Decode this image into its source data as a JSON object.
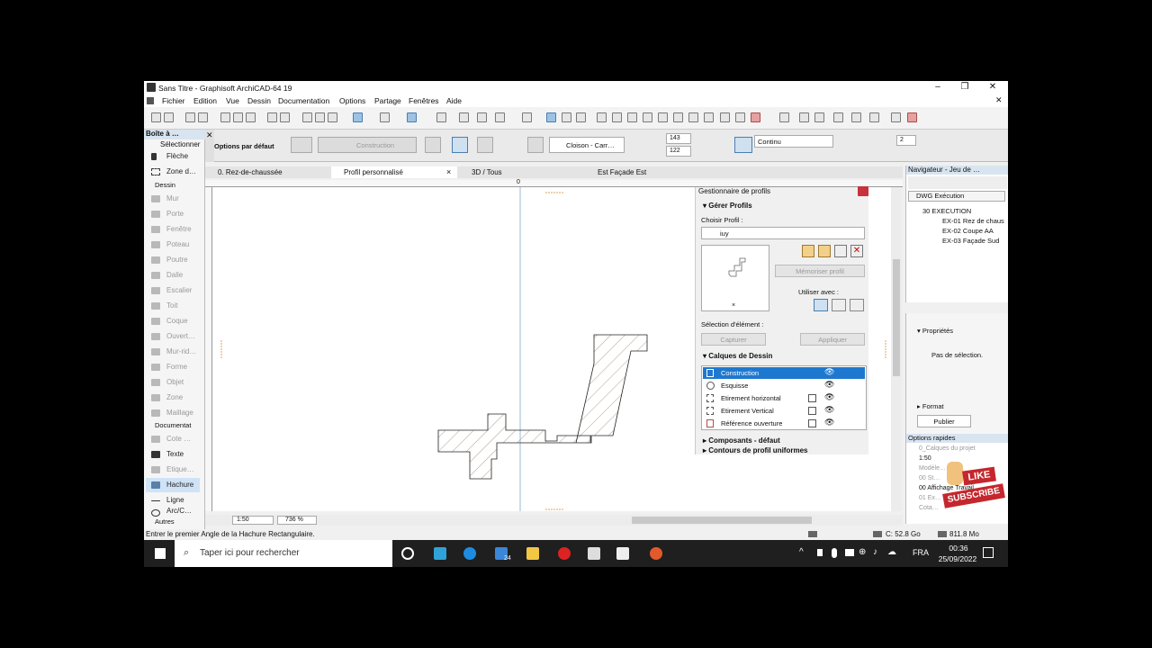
{
  "window": {
    "title": "Sans Titre - Graphisoft ArchiCAD-64 19",
    "min": "–",
    "max": "❐",
    "close": "✕"
  },
  "menus": [
    "Fichier",
    "Edition",
    "Vue",
    "Dessin",
    "Documentation",
    "Options",
    "Partage",
    "Fenêtres",
    "Aide"
  ],
  "infobox": {
    "options": "Options par défaut",
    "layer": "Construction",
    "fill": "Cloison - Carr…",
    "pen1": "143",
    "pen2": "122",
    "line": "Continu",
    "scale_val": "2"
  },
  "toolbox": {
    "header": "Boîte à …",
    "select_label": "Sélectionner",
    "tools": [
      {
        "label": "Flèche"
      },
      {
        "label": "Zone d…"
      }
    ],
    "dessin_header": "Dessin",
    "dessin_tools": [
      "Mur",
      "Porte",
      "Fenêtre",
      "Poteau",
      "Poutre",
      "Dalle",
      "Escalier",
      "Toit",
      "Coque",
      "Ouvert…",
      "Mur-rid…",
      "Forme",
      "Objet",
      "Zone",
      "Maillage"
    ],
    "doc_header": "Documentat",
    "doc_tools": [
      "Cote …",
      "Texte",
      "Etique…",
      "Hachure",
      "Ligne",
      "Arc/C…"
    ],
    "autres": "Autres"
  },
  "tabs": [
    "0. Rez-de-chaussée",
    "Profil personnalisé",
    "3D / Tous",
    "Est Façade Est"
  ],
  "tab_close": "×",
  "canvas_origin": "0",
  "profile_manager": {
    "title": "Gestionnaire de profils",
    "gerer": "Gérer Profils",
    "choisir": "Choisir Profil :",
    "profile_name": "iuy",
    "memoriser": "Mémoriser profil",
    "utiliser": "Utiliser avec :",
    "selection": "Sélection d'élément :",
    "capturer": "Capturer",
    "appliquer": "Appliquer",
    "calques": "Calques de Dessin",
    "layers": [
      "Construction",
      "Esquisse",
      "Etirement horizontal",
      "Etirement Vertical",
      "Référence ouverture"
    ],
    "composants": "Composants - défaut",
    "contours": "Contours de profil uniformes"
  },
  "navigator": {
    "title": "Navigateur - Jeu de …",
    "set": "DWG Exécution",
    "folder": "30 EXECUTION",
    "items": [
      "EX-01 Rez de chaus",
      "EX-02 Coupe AA",
      "EX-03 Façade Sud"
    ]
  },
  "properties": {
    "label": "Propriétés",
    "empty": "Pas de sélection.",
    "format": "Format",
    "publish": "Publier"
  },
  "quick": {
    "title": "Options rapides",
    "rows": [
      "0_Calques du projet",
      "1:50",
      "Modèle…",
      "00 St…",
      "00 Affichage Travail",
      "01 Ex…",
      "Cota…"
    ]
  },
  "bottom": {
    "scale": "1:50",
    "zoom": "736 %"
  },
  "status": {
    "hint": "Entrer le premier Angle de la Hachure Rectangulaire.",
    "disk": "C: 52.8 Go",
    "mem": "811.8 Mo"
  },
  "taskbar": {
    "search": "Taper ici pour rechercher",
    "lang": "FRA",
    "time": "00:36",
    "date": "25/09/2022",
    "mail_badge": "24"
  },
  "badge": {
    "like": "LIKE",
    "subscribe": "SUBSCRIBE"
  }
}
